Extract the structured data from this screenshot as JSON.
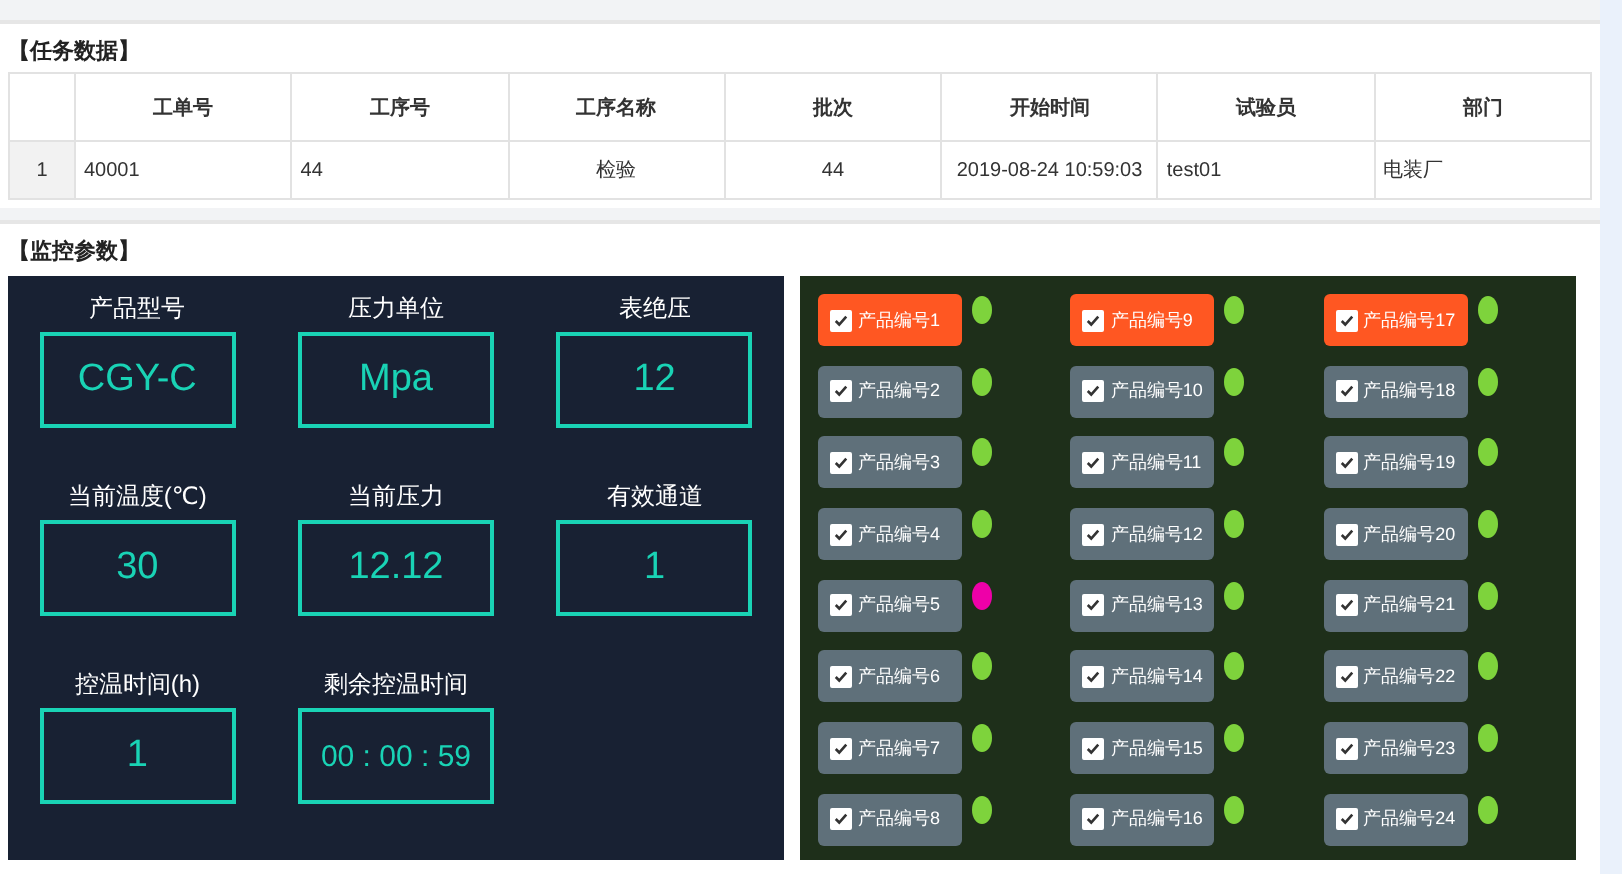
{
  "task_section": {
    "title": "【任务数据】"
  },
  "task_table": {
    "columns": [
      "工单号",
      "工序号",
      "工序名称",
      "批次",
      "开始时间",
      "试验员",
      "部门"
    ],
    "rows": [
      {
        "index": "1",
        "cells": [
          "40001",
          "44",
          "检验",
          "44",
          "2019-08-24 10:59:03",
          "test01",
          "电装厂"
        ]
      }
    ]
  },
  "monitor_section": {
    "title": "【监控参数】"
  },
  "params": [
    {
      "label": "产品型号",
      "value": "CGY-C"
    },
    {
      "label": "压力单位",
      "value": "Mpa"
    },
    {
      "label": "表绝压",
      "value": "12"
    },
    {
      "label": "当前温度(℃)",
      "value": "30"
    },
    {
      "label": "当前压力",
      "value": "12.12"
    },
    {
      "label": "有效通道",
      "value": "1"
    },
    {
      "label": "控温时间(h)",
      "value": "1"
    },
    {
      "label": "剩余控温时间",
      "value": "00 : 00 : 59"
    }
  ],
  "channels": [
    {
      "label": "产品编号1",
      "checked": true,
      "selected": true,
      "color": "#7ed33c"
    },
    {
      "label": "产品编号2",
      "checked": true,
      "selected": false,
      "color": "#7ed33c"
    },
    {
      "label": "产品编号3",
      "checked": true,
      "selected": false,
      "color": "#7ed33c"
    },
    {
      "label": "产品编号4",
      "checked": true,
      "selected": false,
      "color": "#7ed33c"
    },
    {
      "label": "产品编号5",
      "checked": true,
      "selected": false,
      "color": "#ee00a8"
    },
    {
      "label": "产品编号6",
      "checked": true,
      "selected": false,
      "color": "#7ed33c"
    },
    {
      "label": "产品编号7",
      "checked": true,
      "selected": false,
      "color": "#7ed33c"
    },
    {
      "label": "产品编号8",
      "checked": true,
      "selected": false,
      "color": "#7ed33c"
    },
    {
      "label": "产品编号9",
      "checked": true,
      "selected": true,
      "color": "#7ed33c"
    },
    {
      "label": "产品编号10",
      "checked": true,
      "selected": false,
      "color": "#7ed33c"
    },
    {
      "label": "产品编号11",
      "checked": true,
      "selected": false,
      "color": "#7ed33c"
    },
    {
      "label": "产品编号12",
      "checked": true,
      "selected": false,
      "color": "#7ed33c"
    },
    {
      "label": "产品编号13",
      "checked": true,
      "selected": false,
      "color": "#7ed33c"
    },
    {
      "label": "产品编号14",
      "checked": true,
      "selected": false,
      "color": "#7ed33c"
    },
    {
      "label": "产品编号15",
      "checked": true,
      "selected": false,
      "color": "#7ed33c"
    },
    {
      "label": "产品编号16",
      "checked": true,
      "selected": false,
      "color": "#7ed33c"
    },
    {
      "label": "产品编号17",
      "checked": true,
      "selected": true,
      "color": "#7ed33c"
    },
    {
      "label": "产品编号18",
      "checked": true,
      "selected": false,
      "color": "#7ed33c"
    },
    {
      "label": "产品编号19",
      "checked": true,
      "selected": false,
      "color": "#7ed33c"
    },
    {
      "label": "产品编号20",
      "checked": true,
      "selected": false,
      "color": "#7ed33c"
    },
    {
      "label": "产品编号21",
      "checked": true,
      "selected": false,
      "color": "#7ed33c"
    },
    {
      "label": "产品编号22",
      "checked": true,
      "selected": false,
      "color": "#7ed33c"
    },
    {
      "label": "产品编号23",
      "checked": true,
      "selected": false,
      "color": "#7ed33c"
    },
    {
      "label": "产品编号24",
      "checked": true,
      "selected": false,
      "color": "#7ed33c"
    }
  ]
}
